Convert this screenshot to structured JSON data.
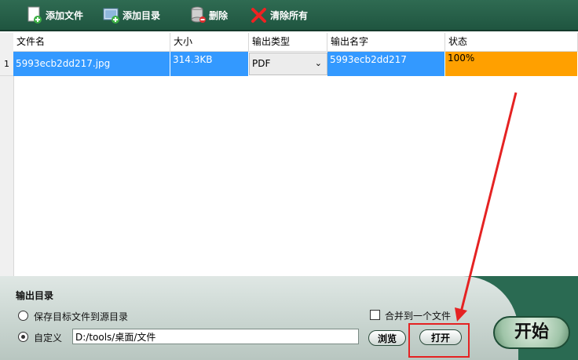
{
  "toolbar": {
    "add_file": "添加文件",
    "add_dir": "添加目录",
    "delete": "删除",
    "clear_all": "清除所有"
  },
  "grid": {
    "headers": {
      "file_name": "文件名",
      "size": "大小",
      "output_type": "输出类型",
      "output_name": "输出名字",
      "status": "状态"
    },
    "rows": [
      {
        "index": "1",
        "file_name": "5993ecb2dd217.jpg",
        "size": "314.3KB",
        "output_type": "PDF",
        "output_name": "5993ecb2dd217",
        "status": "100%"
      }
    ]
  },
  "output": {
    "title": "输出目录",
    "radio_source": "保存目标文件到源目录",
    "radio_custom": "自定义",
    "path": "D:/tools/桌面/文件",
    "merge_label": "合并到一个文件",
    "browse": "浏览",
    "open": "打开",
    "start": "开始"
  },
  "colors": {
    "toolbar_bg": "#2f6b52",
    "selected_row": "#3399ff",
    "status_done": "#ffa000",
    "annotation": "#e52222"
  }
}
